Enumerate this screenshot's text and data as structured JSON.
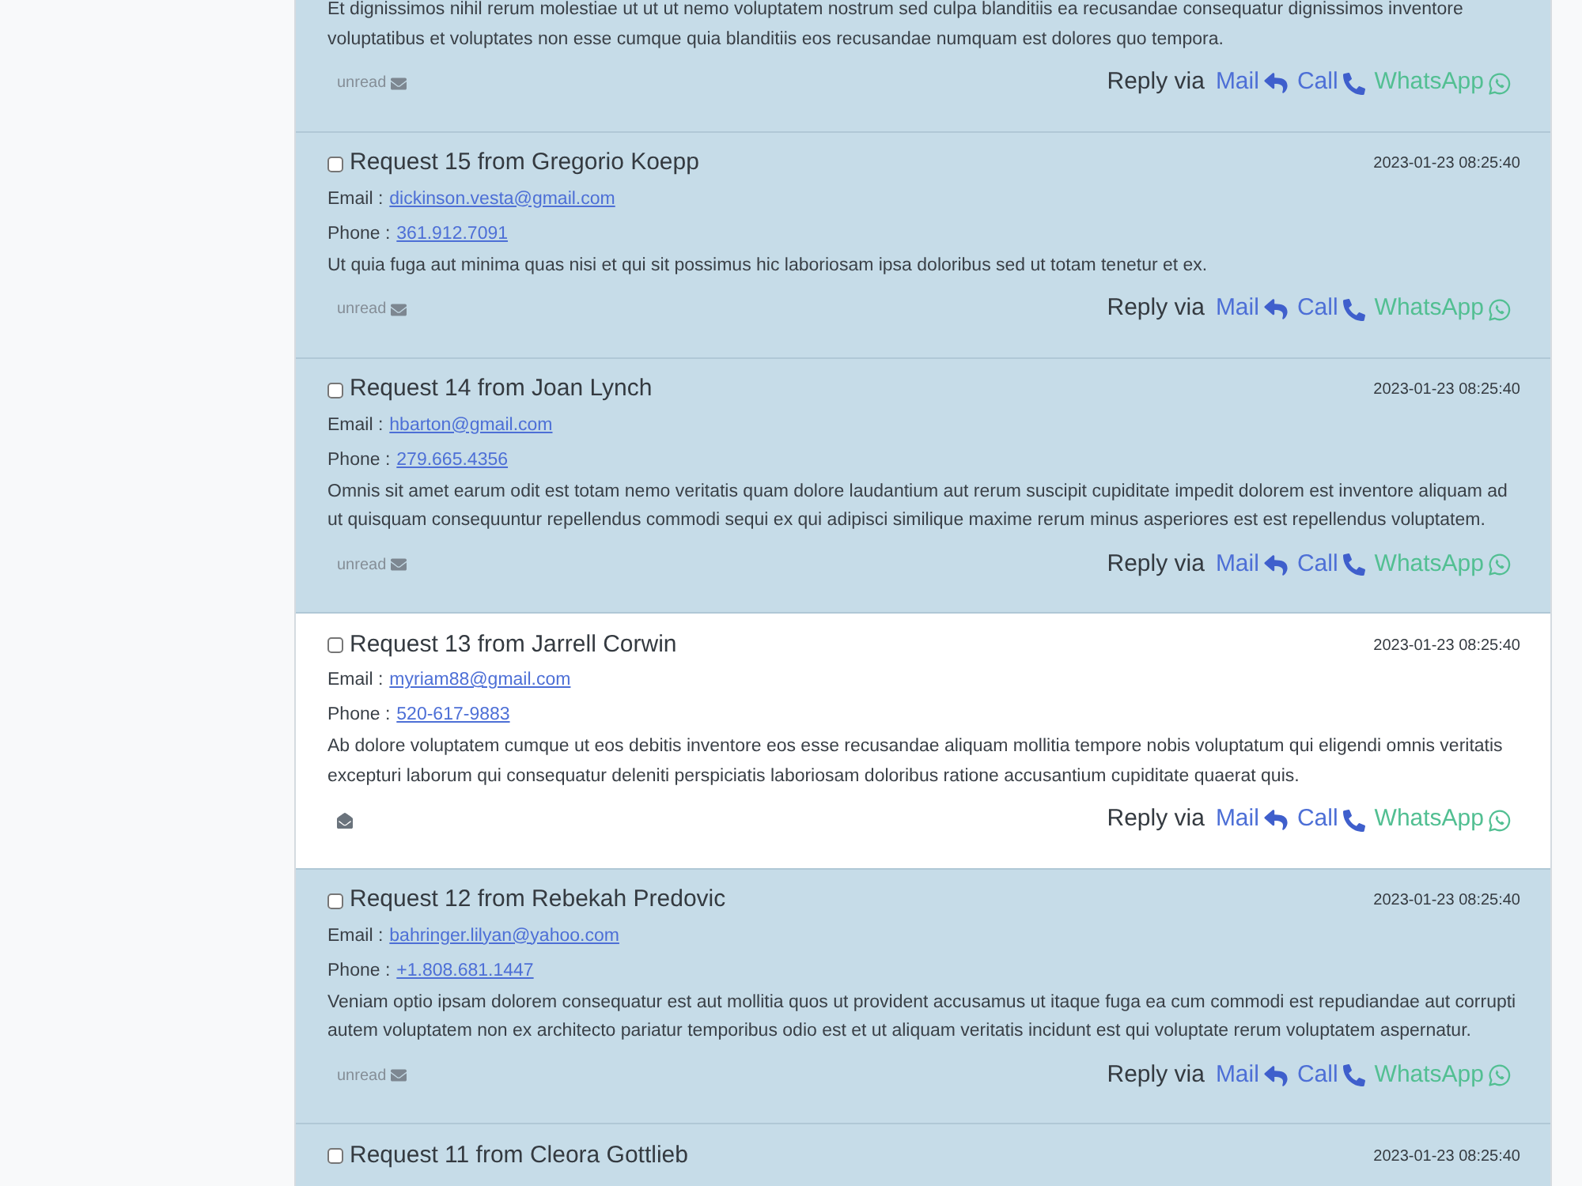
{
  "messages": [
    {
      "unread": true,
      "body": "Et dignissimos nihil rerum molestiae ut ut ut nemo voluptatem nostrum sed culpa blanditiis ea recusandae consequatur dignissimos inventore voluptatibus et voluptates non esse cumque quia blanditiis eos recusandae numquam est dolores quo tempora.",
      "status_label": "unread",
      "reply": {
        "label": "Reply via",
        "options": [
          {
            "kind": "mail",
            "label": "Mail"
          },
          {
            "kind": "call",
            "label": "Call"
          },
          {
            "kind": "whatsapp",
            "label": "WhatsApp"
          }
        ]
      }
    },
    {
      "checked": false,
      "title": "Request 15 from Gregorio Koepp",
      "timestamp": "2023-01-23 08:25:40",
      "email": {
        "label": "Email :",
        "value": "dickinson.vesta@gmail.com"
      },
      "phone": {
        "label": "Phone :",
        "value": "361.912.7091"
      },
      "body": "Ut quia fuga aut minima quas nisi et qui sit possimus hic laboriosam ipsa doloribus sed ut totam tenetur et ex.",
      "unread": true,
      "status_label": "unread",
      "reply": {
        "label": "Reply via",
        "options": [
          {
            "kind": "mail",
            "label": "Mail"
          },
          {
            "kind": "call",
            "label": "Call"
          },
          {
            "kind": "whatsapp",
            "label": "WhatsApp"
          }
        ]
      }
    },
    {
      "checked": false,
      "title": "Request 14 from Joan Lynch",
      "timestamp": "2023-01-23 08:25:40",
      "email": {
        "label": "Email :",
        "value": "hbarton@gmail.com"
      },
      "phone": {
        "label": "Phone :",
        "value": "279.665.4356"
      },
      "body": "Omnis sit amet earum odit est totam nemo veritatis quam dolore laudantium aut rerum suscipit cupiditate impedit dolorem est inventore aliquam ad ut quisquam consequuntur repellendus commodi sequi ex qui adipisci similique maxime rerum minus asperiores est est repellendus voluptatem.",
      "unread": true,
      "status_label": "unread",
      "reply": {
        "label": "Reply via",
        "options": [
          {
            "kind": "mail",
            "label": "Mail"
          },
          {
            "kind": "call",
            "label": "Call"
          },
          {
            "kind": "whatsapp",
            "label": "WhatsApp"
          }
        ]
      }
    },
    {
      "checked": false,
      "title": "Request 13 from Jarrell Corwin",
      "timestamp": "2023-01-23 08:25:40",
      "email": {
        "label": "Email :",
        "value": "myriam88@gmail.com"
      },
      "phone": {
        "label": "Phone :",
        "value": "520-617-9883"
      },
      "body": "Ab dolore voluptatem cumque ut eos debitis inventore eos esse recusandae aliquam mollitia tempore nobis voluptatum qui eligendi omnis veritatis excepturi laborum qui consequatur deleniti perspiciatis laboriosam doloribus ratione accusantium cupiditate quaerat quis.",
      "unread": false,
      "reply": {
        "label": "Reply via",
        "options": [
          {
            "kind": "mail",
            "label": "Mail"
          },
          {
            "kind": "call",
            "label": "Call"
          },
          {
            "kind": "whatsapp",
            "label": "WhatsApp"
          }
        ]
      }
    },
    {
      "checked": false,
      "title": "Request 12 from Rebekah Predovic",
      "timestamp": "2023-01-23 08:25:40",
      "email": {
        "label": "Email :",
        "value": "bahringer.lilyan@yahoo.com"
      },
      "phone": {
        "label": "Phone :",
        "value": "+1.808.681.1447"
      },
      "body": "Veniam optio ipsam dolorem consequatur est aut mollitia quos ut provident accusamus ut itaque fuga ea cum commodi est repudiandae aut corrupti autem voluptatem non ex architecto pariatur temporibus odio est et ut aliquam veritatis incidunt est qui voluptate rerum voluptatem aspernatur.",
      "unread": true,
      "status_label": "unread",
      "reply": {
        "label": "Reply via",
        "options": [
          {
            "kind": "mail",
            "label": "Mail"
          },
          {
            "kind": "call",
            "label": "Call"
          },
          {
            "kind": "whatsapp",
            "label": "WhatsApp"
          }
        ]
      }
    },
    {
      "checked": false,
      "title": "Request 11 from Cleora Gottlieb",
      "timestamp": "2023-01-23 08:25:40",
      "unread": true
    }
  ]
}
